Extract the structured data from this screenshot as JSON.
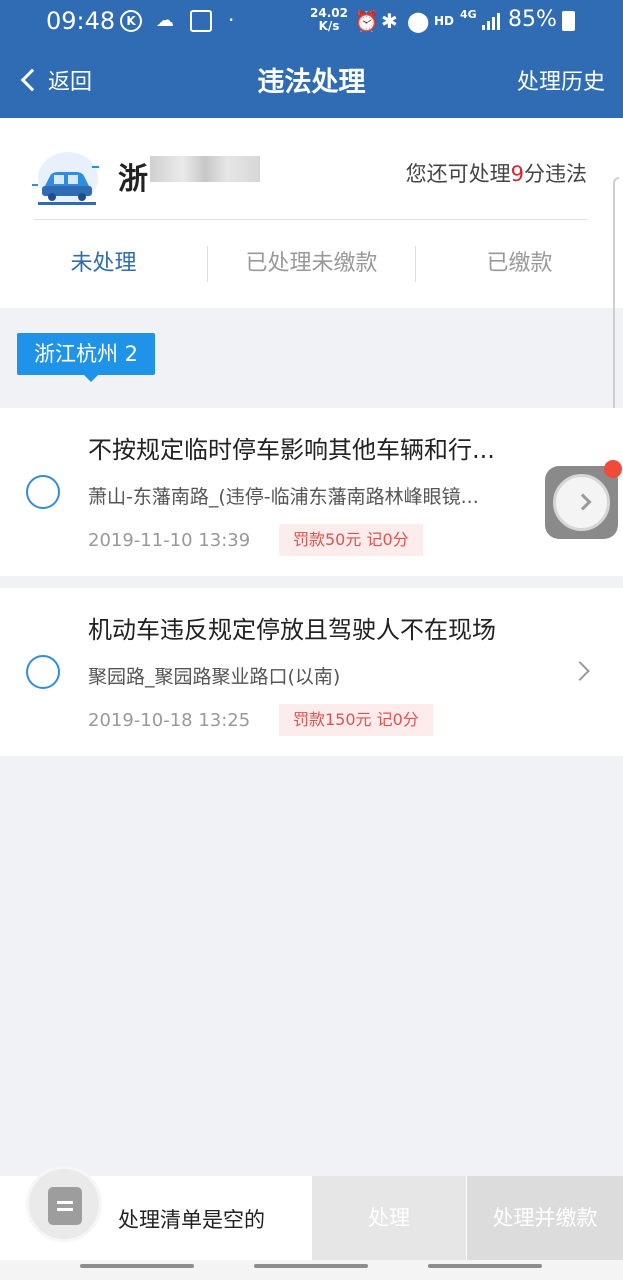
{
  "status_bar": {
    "time": "09:48",
    "k_label": "K",
    "speed_value": "24.02",
    "speed_unit": "K/s",
    "hd": "HD",
    "network": "4G",
    "battery": "85%"
  },
  "header": {
    "back_label": "返回",
    "title": "违法处理",
    "history_label": "处理历史",
    "color": "#2f6cb3"
  },
  "vehicle": {
    "plate_prefix": "浙",
    "remain_prefix": "您还可处理",
    "remain_count": "9",
    "remain_suffix": "分违法"
  },
  "tabs": [
    {
      "label": "未处理",
      "active": true
    },
    {
      "label": "已处理未缴款",
      "active": false
    },
    {
      "label": "已缴款",
      "active": false
    }
  ],
  "region": {
    "label": "浙江杭州 2",
    "color": "#1f93e8"
  },
  "violations": [
    {
      "title": "不按规定临时停车影响其他车辆和行...",
      "place": "萧山-东藩南路_(违停-临浦东藩南路林峰眼镜...",
      "date": "2019-11-10 13:39",
      "fine": "罚款50元 记0分"
    },
    {
      "title": "机动车违反规定停放且驾驶人不在现场",
      "place": "聚园路_聚园路聚业路口(以南)",
      "date": "2019-10-18 13:25",
      "fine": "罚款150元 记0分"
    }
  ],
  "bottom_bar": {
    "empty_text": "处理清单是空的",
    "process_label": "处理",
    "process_pay_label": "处理并缴款"
  }
}
